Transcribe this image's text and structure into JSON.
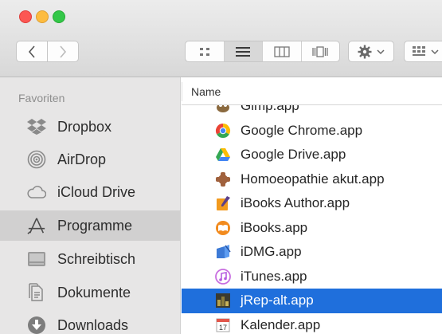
{
  "sidebar": {
    "heading": "Favoriten",
    "items": [
      {
        "label": "Dropbox",
        "icon": "dropbox-icon"
      },
      {
        "label": "AirDrop",
        "icon": "airdrop-icon"
      },
      {
        "label": "iCloud Drive",
        "icon": "cloud-icon"
      },
      {
        "label": "Programme",
        "icon": "applications-icon",
        "selected": true
      },
      {
        "label": "Schreibtisch",
        "icon": "desktop-icon"
      },
      {
        "label": "Dokumente",
        "icon": "documents-icon"
      },
      {
        "label": "Downloads",
        "icon": "downloads-icon"
      }
    ]
  },
  "list": {
    "column_header": "Name",
    "rows": [
      {
        "name": "Gimp.app",
        "icon": "gimp-icon"
      },
      {
        "name": "Google Chrome.app",
        "icon": "chrome-icon"
      },
      {
        "name": "Google Drive.app",
        "icon": "google-drive-icon"
      },
      {
        "name": "Homoeopathie akut.app",
        "icon": "homoeopathie-icon"
      },
      {
        "name": "iBooks Author.app",
        "icon": "ibooks-author-icon"
      },
      {
        "name": "iBooks.app",
        "icon": "ibooks-icon"
      },
      {
        "name": "iDMG.app",
        "icon": "idmg-icon"
      },
      {
        "name": "iTunes.app",
        "icon": "itunes-icon"
      },
      {
        "name": "jRep-alt.app",
        "icon": "jrep-icon",
        "selected": true
      },
      {
        "name": "Kalender.app",
        "icon": "calendar-icon"
      }
    ]
  },
  "colors": {
    "selection": "#1f6fdc",
    "sidebar_bg": "#e7e6e6",
    "sidebar_selected": "#d1d0d0"
  }
}
